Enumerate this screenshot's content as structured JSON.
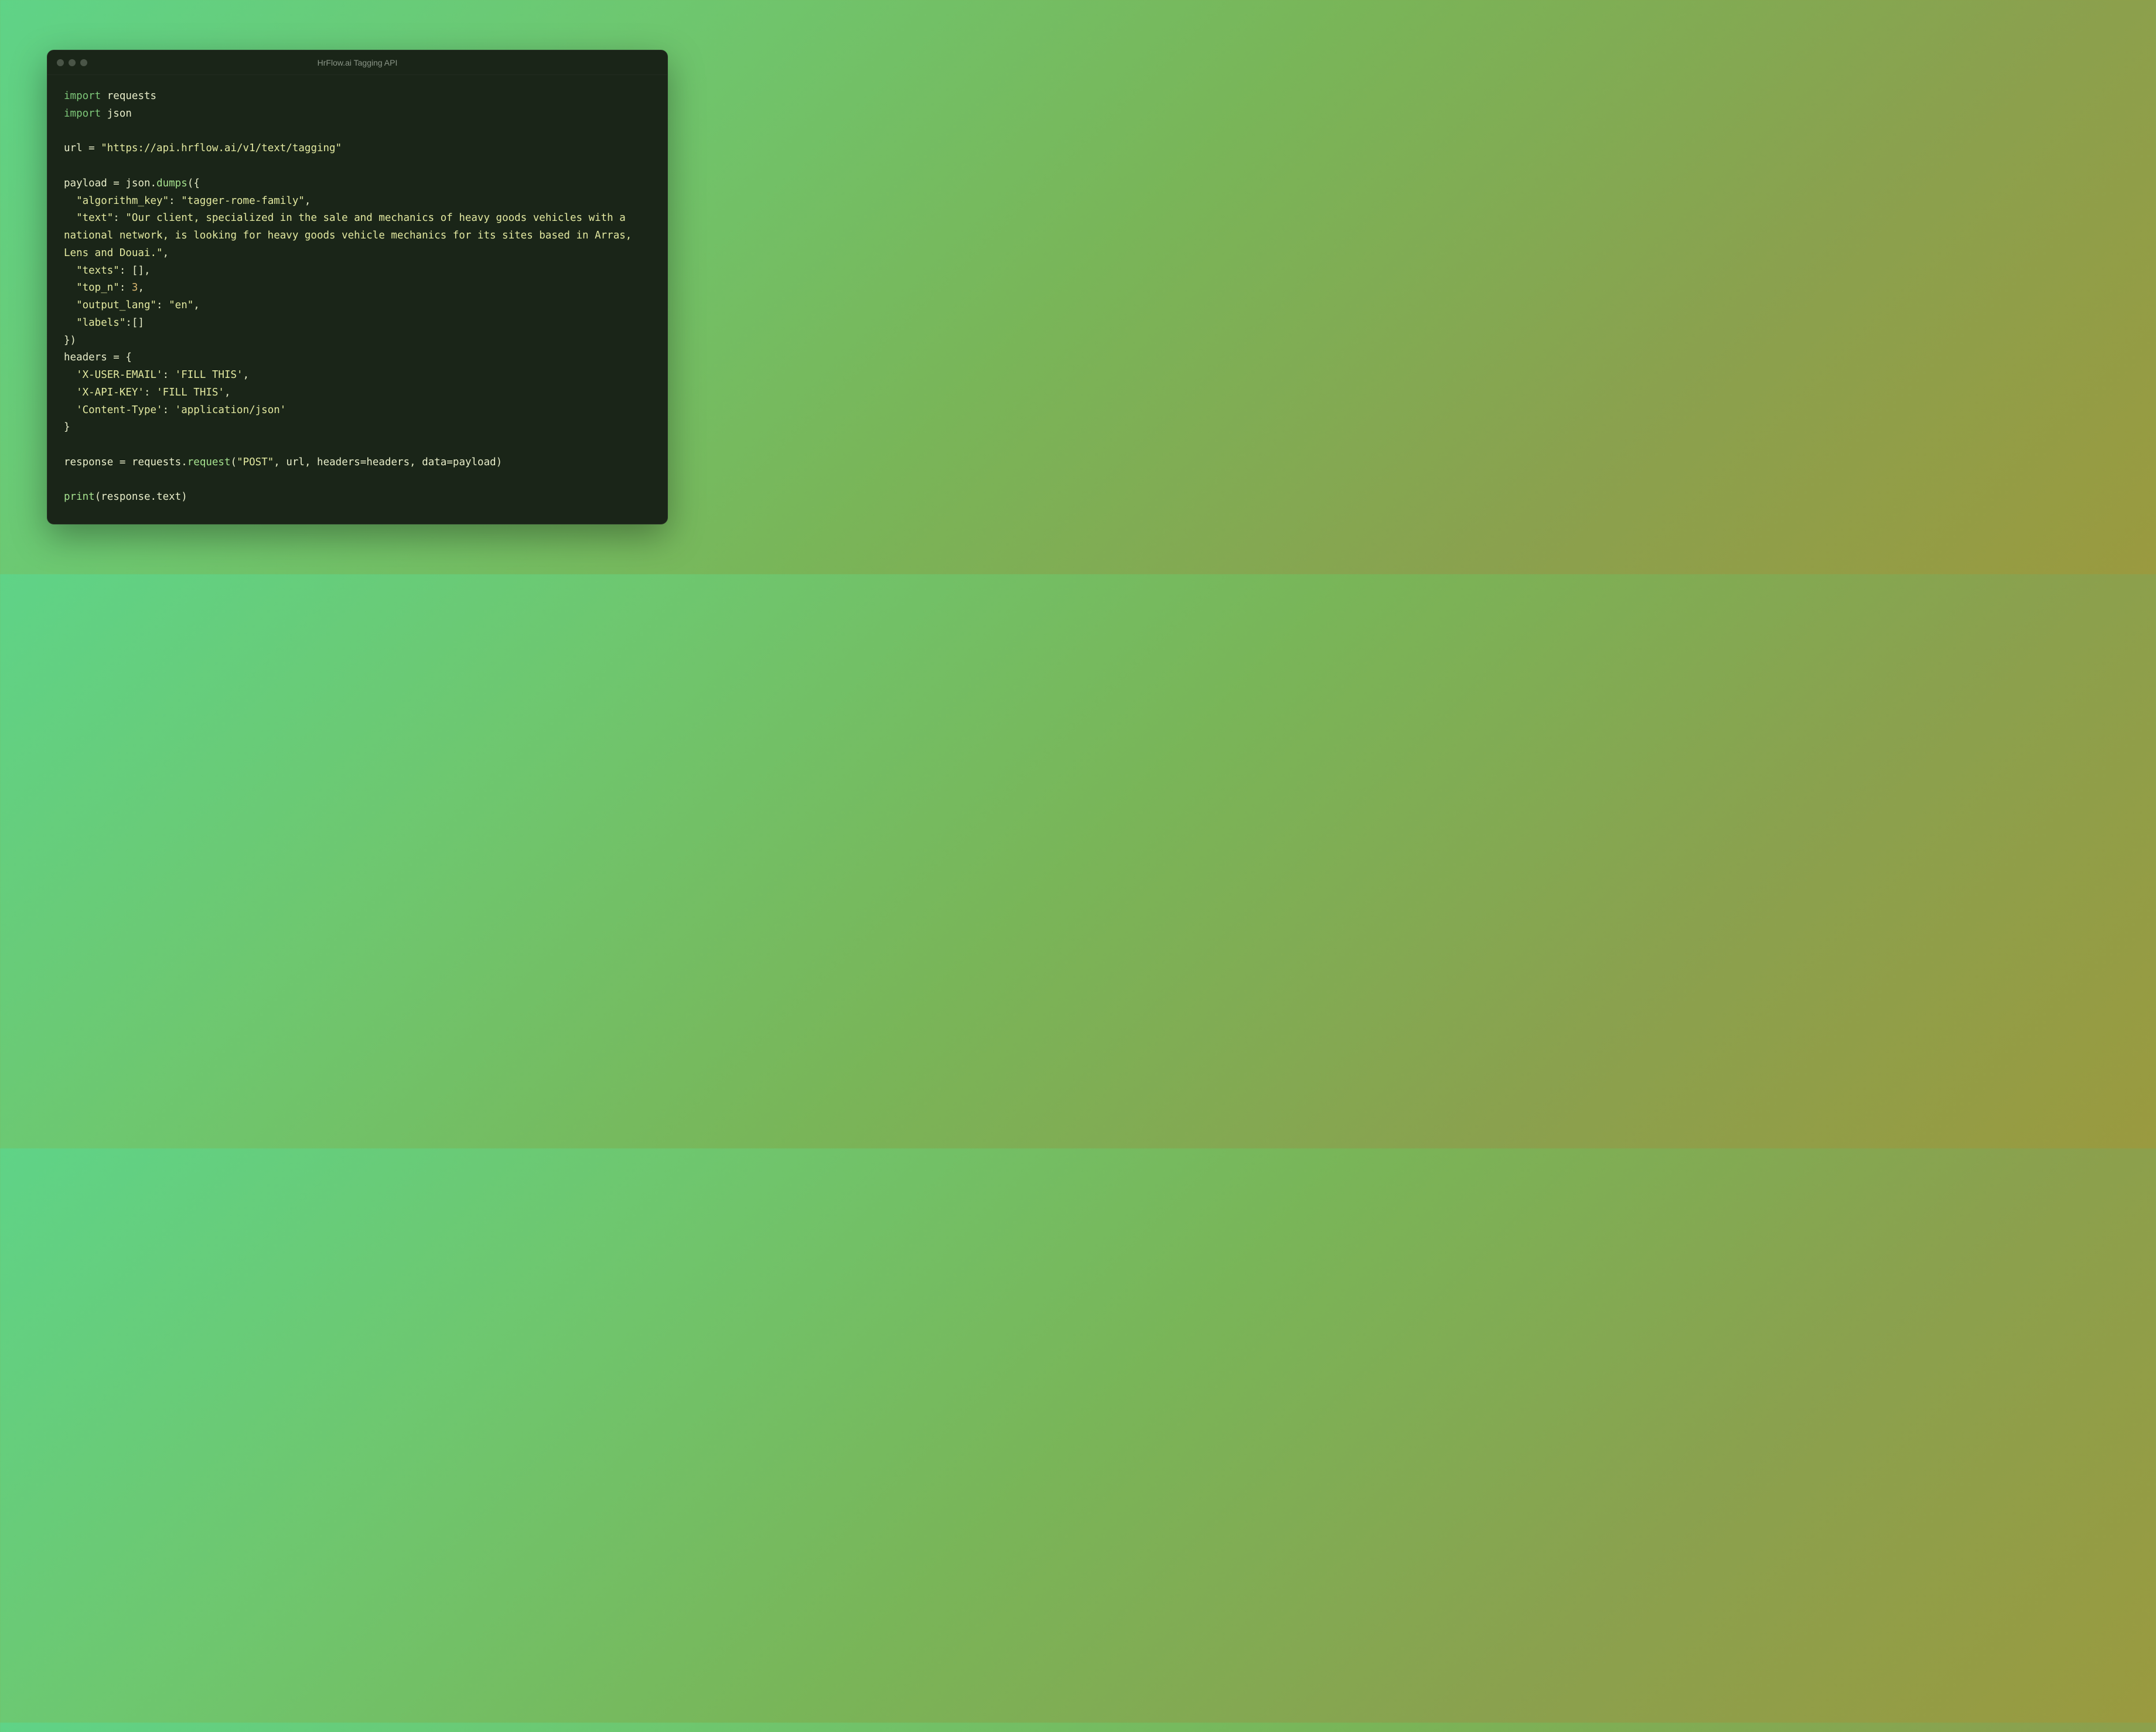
{
  "window": {
    "title": "HrFlow.ai Tagging API"
  },
  "code": {
    "import_kw": "import",
    "mod_requests": "requests",
    "mod_json": "json",
    "url_var": "url",
    "eq": " = ",
    "url_str": "\"https://api.hrflow.ai/v1/text/tagging\"",
    "payload_var": "payload",
    "json_ref": "json",
    "dot": ".",
    "dumps": "dumps",
    "open_paren": "(",
    "close_paren": ")",
    "open_brace": "{",
    "close_brace": "}",
    "close_brace_paren": "})",
    "k_algo": "\"algorithm_key\"",
    "colon_sp": ": ",
    "v_algo": "\"tagger-rome-family\"",
    "comma": ",",
    "k_text": "\"text\"",
    "v_text": "\"Our client, specialized in the sale and mechanics of heavy goods vehicles with a national network, is looking for heavy goods vehicle mechanics for its sites based in Arras, Lens and Douai.\"",
    "k_texts": "\"texts\"",
    "empty_arr": "[]",
    "k_topn": "\"top_n\"",
    "v_topn": "3",
    "k_outlang": "\"output_lang\"",
    "v_outlang": "\"en\"",
    "k_labels": "\"labels\"",
    "colon": ":",
    "headers_var": "headers",
    "hk_email": "'X-USER-EMAIL'",
    "hv_fill": "'FILL THIS'",
    "hk_api": "'X-API-KEY'",
    "hk_ct": "'Content-Type'",
    "hv_ct": "'application/json'",
    "response_var": "response",
    "requests_ref": "requests",
    "request_func": "request",
    "post_str": "\"POST\"",
    "comma_sp": ", ",
    "url_ref": "url",
    "headers_kw": "headers",
    "headers_ref": "headers",
    "eq_nosp": "=",
    "data_kw": "data",
    "payload_ref": "payload",
    "print_fn": "print",
    "text_attr": "text",
    "indent": "  "
  }
}
